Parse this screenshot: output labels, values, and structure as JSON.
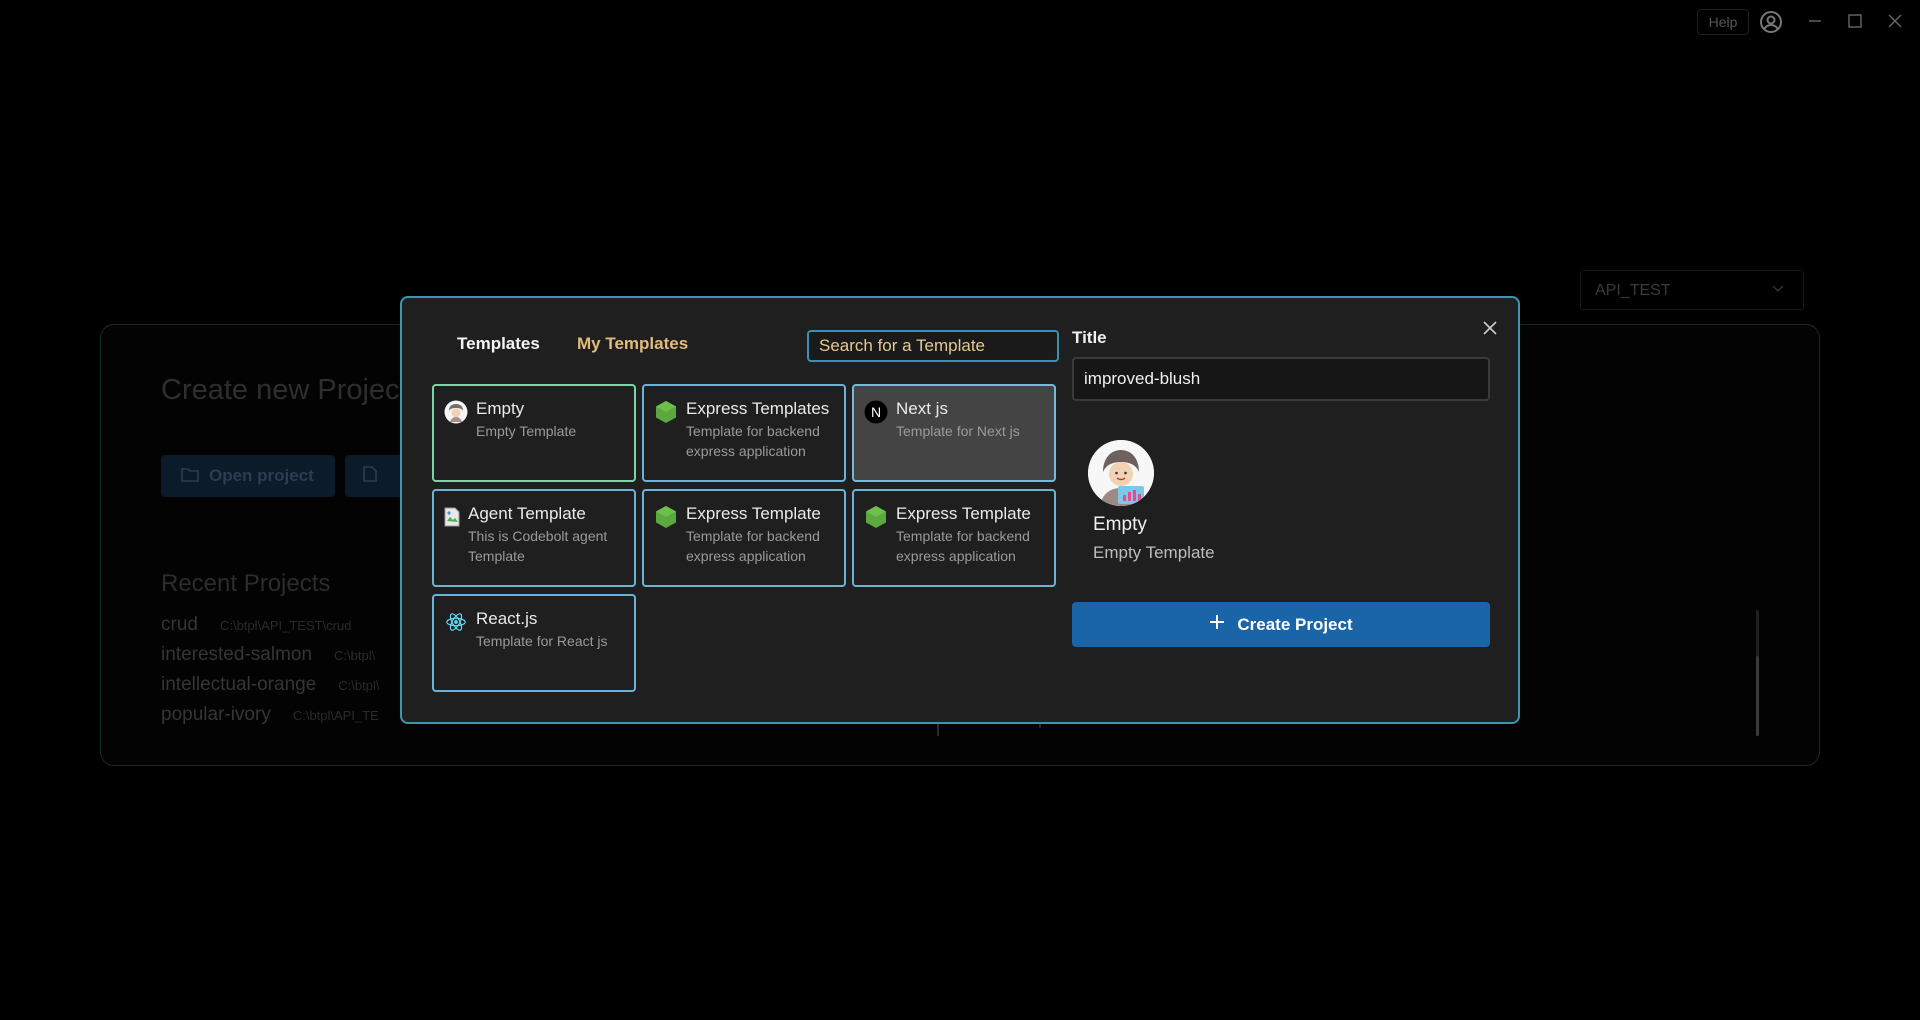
{
  "titlebar": {
    "help_label": "Help",
    "account_icon": "account-circle-icon",
    "minimize_icon": "minimize-icon",
    "maximize_icon": "maximize-icon",
    "close_icon": "close-icon"
  },
  "background": {
    "workspace_select": "API_TEST",
    "page_title": "Create new Projec",
    "open_project_label": "Open project",
    "recent_title": "Recent Projects",
    "recent_projects": [
      {
        "name": "crud",
        "path": "C:\\btpl\\API_TEST\\crud"
      },
      {
        "name": "interested-salmon",
        "path": "C:\\btpl\\"
      },
      {
        "name": "intellectual-orange",
        "path": "C:\\btpl\\"
      },
      {
        "name": "popular-ivory",
        "path": "C:\\btpl\\API_TE"
      }
    ]
  },
  "modal": {
    "tabs": [
      {
        "label": "Templates",
        "active": true
      },
      {
        "label": "My Templates",
        "active": false
      }
    ],
    "search_placeholder": "Search for a Template",
    "templates": [
      {
        "title": "Empty",
        "desc": "Empty Template",
        "icon": "avatar-icon"
      },
      {
        "title": "Express Templates",
        "desc": "Template for backend express application",
        "icon": "nodejs-hexagon-icon"
      },
      {
        "title": "Next js",
        "desc": "Template for Next js",
        "icon": "nextjs-icon"
      },
      {
        "title": "Agent Template",
        "desc": "This is Codebolt agent Template",
        "icon": "broken-image-icon"
      },
      {
        "title": "Express Template",
        "desc": "Template for backend express application",
        "icon": "nodejs-hexagon-icon"
      },
      {
        "title": "Express Template",
        "desc": "Template for backend express application",
        "icon": "nodejs-hexagon-icon"
      },
      {
        "title": "React.js",
        "desc": "Template for React js",
        "icon": "react-atom-icon"
      }
    ],
    "title_label": "Title",
    "title_value": "improved-blush",
    "preview": {
      "name": "Empty",
      "desc": "Empty Template"
    },
    "create_label": "Create Project",
    "colors": {
      "accent": "#3e95ad",
      "create_button": "#1a65a8",
      "my_templates_tab": "#e2bb7a"
    }
  }
}
